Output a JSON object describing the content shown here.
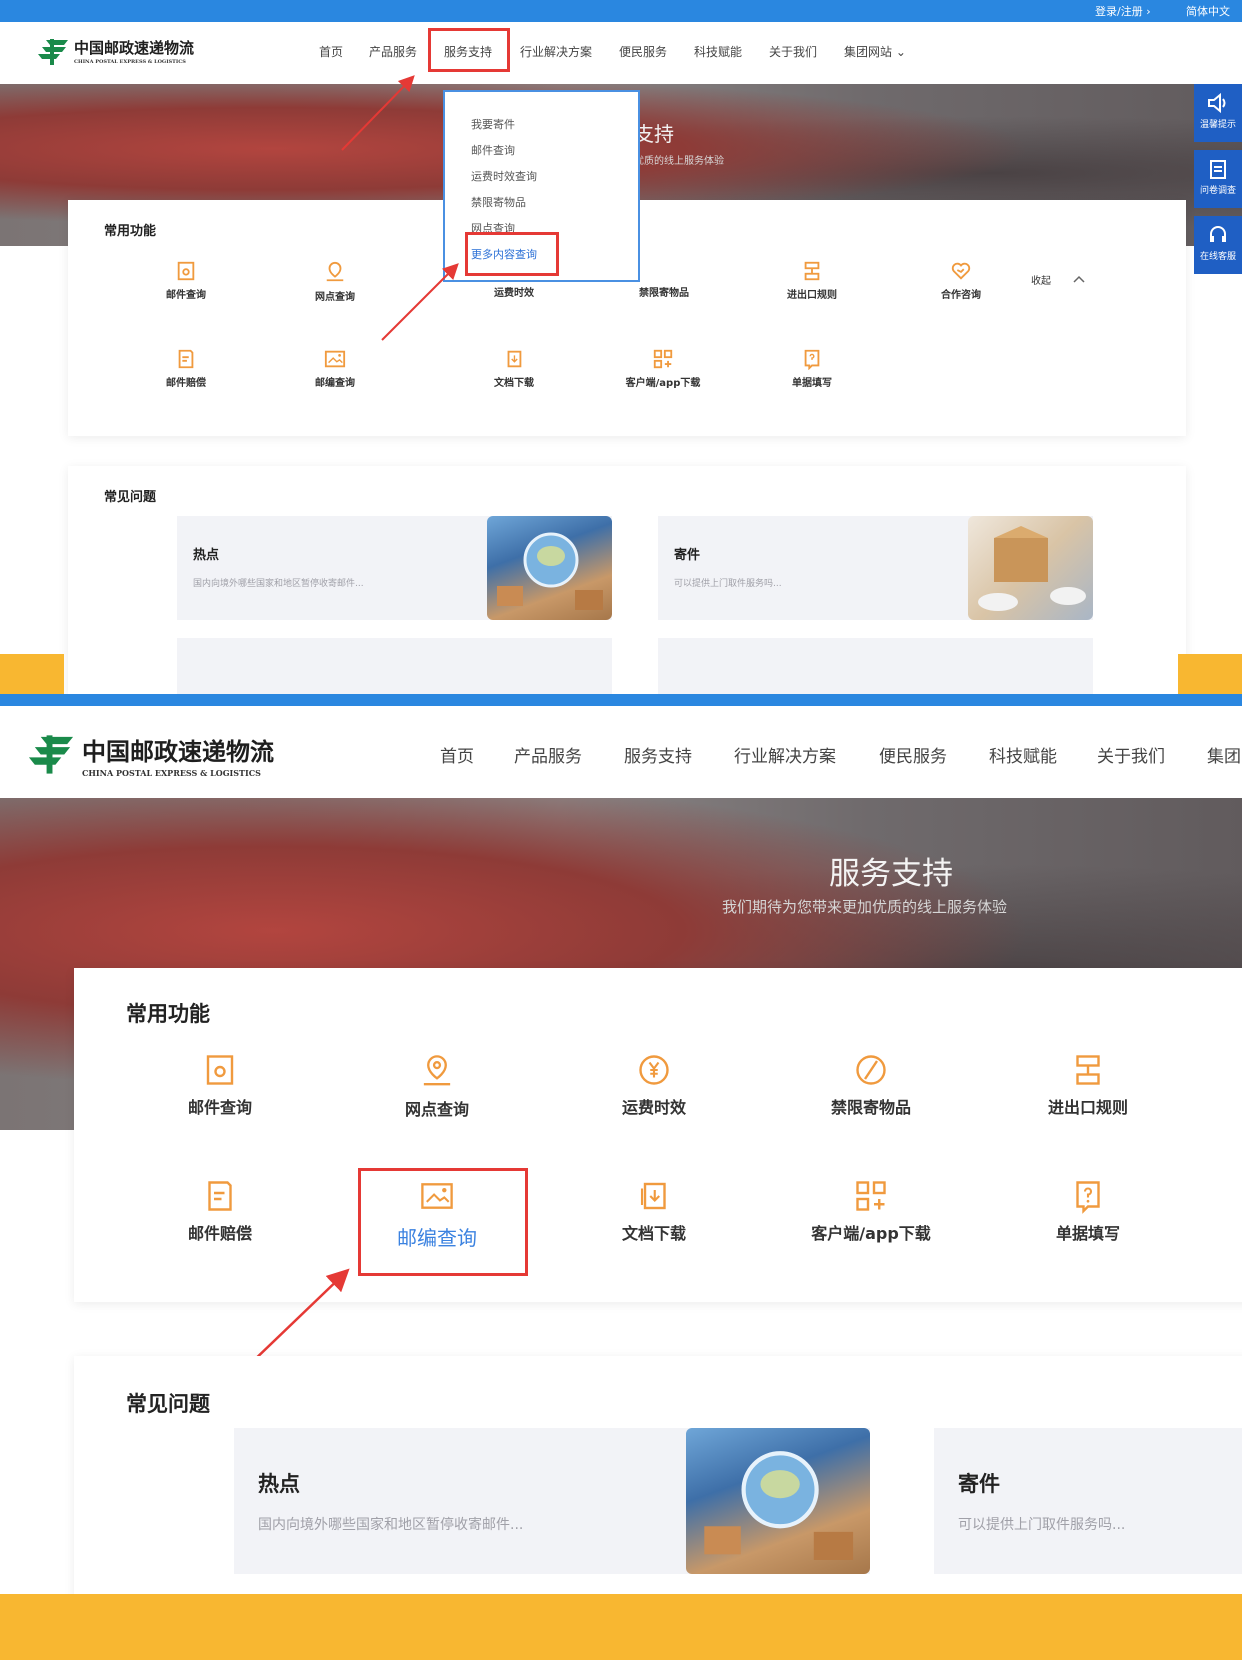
{
  "colors": {
    "accent_blue": "#2a87e0",
    "postal_green": "#1a8a4a",
    "highlight_red": "#e53935",
    "icon_orange": "#f09a3e",
    "frame_yellow": "#f8b731"
  },
  "topbar": {
    "login": "登录/注册 ›",
    "language": "简体中文"
  },
  "logo": {
    "cn": "中国邮政速递物流",
    "en": "CHINA POSTAL EXPRESS & LOGISTICS"
  },
  "nav": [
    {
      "label": "首页"
    },
    {
      "label": "产品服务"
    },
    {
      "label": "服务支持"
    },
    {
      "label": "行业解决方案"
    },
    {
      "label": "便民服务"
    },
    {
      "label": "科技赋能"
    },
    {
      "label": "关于我们"
    },
    {
      "label": "集团网站 ⌄"
    }
  ],
  "nav_p2_last": "集团",
  "dropdown": [
    "我要寄件",
    "邮件查询",
    "运费时效查询",
    "禁限寄物品",
    "网点查询",
    "更多内容查询"
  ],
  "hero": {
    "title": "服务支持",
    "subtitle": "我们期待为您带来更加优质的线上服务体验",
    "title_partial": "支持",
    "subtitle_partial": "优质的线上服务体验"
  },
  "side_buttons": [
    {
      "icon": "speaker-icon",
      "label": "温馨提示"
    },
    {
      "icon": "clipboard-icon",
      "label": "问卷调查"
    },
    {
      "icon": "headset-icon",
      "label": "在线客服"
    }
  ],
  "common_functions": {
    "title": "常用功能",
    "collapse": "收起",
    "items": [
      {
        "label": "邮件查询",
        "icon": "mail-search-icon"
      },
      {
        "label": "网点查询",
        "icon": "location-pin-icon"
      },
      {
        "label": "运费时效",
        "icon": "yen-clock-icon"
      },
      {
        "label": "禁限寄物品",
        "icon": "prohibited-icon"
      },
      {
        "label": "进出口规则",
        "icon": "import-export-icon"
      },
      {
        "label": "合作咨询",
        "icon": "handshake-icon"
      },
      {
        "label": "邮件赔偿",
        "icon": "compensation-doc-icon"
      },
      {
        "label": "邮编查询",
        "icon": "postcode-card-icon"
      },
      {
        "label": "文档下载",
        "icon": "document-download-icon"
      },
      {
        "label": "客户端/app下载",
        "icon": "app-grid-icon"
      },
      {
        "label": "单据填写",
        "icon": "form-question-icon"
      }
    ]
  },
  "faq": {
    "title": "常见问题",
    "items": [
      {
        "title": "热点",
        "desc": "国内向境外哪些国家和地区暂停收寄邮件..."
      },
      {
        "title": "寄件",
        "desc": "可以提供上门取件服务吗..."
      }
    ]
  }
}
